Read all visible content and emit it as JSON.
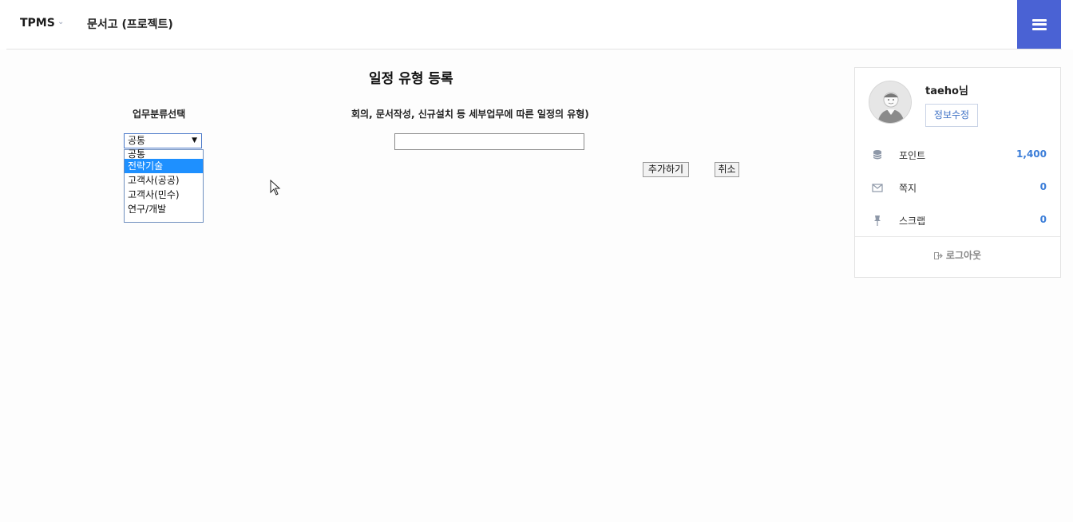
{
  "header": {
    "brand": "TPMS",
    "brand_chevron": "⌄",
    "breadcrumb": "문서고 (프로젝트)",
    "menu_icon": "hamburger-icon",
    "accent_color": "#4a62d4"
  },
  "form": {
    "title": "일정 유형 등록",
    "category_label": "업무분류선택",
    "type_label": "회의, 문서작성, 신규설치 등 세부업무에 따른 일정의 유형)",
    "category_select": {
      "selected": "공통",
      "options": [
        "공통",
        "전략기술",
        "고객사(공공)",
        "고객사(민수)",
        "연구/개발"
      ],
      "highlighted": "전략기술"
    },
    "type_input_value": "",
    "add_button": "추가하기",
    "cancel_button": "취소"
  },
  "profile": {
    "username": "taeho님",
    "edit_button": "정보수정",
    "stats": [
      {
        "icon": "database-icon",
        "label": "포인트",
        "value": "1,400"
      },
      {
        "icon": "envelope-icon",
        "label": "쪽지",
        "value": "0"
      },
      {
        "icon": "pin-icon",
        "label": "스크랩",
        "value": "0"
      }
    ],
    "logout": "로그아웃"
  }
}
